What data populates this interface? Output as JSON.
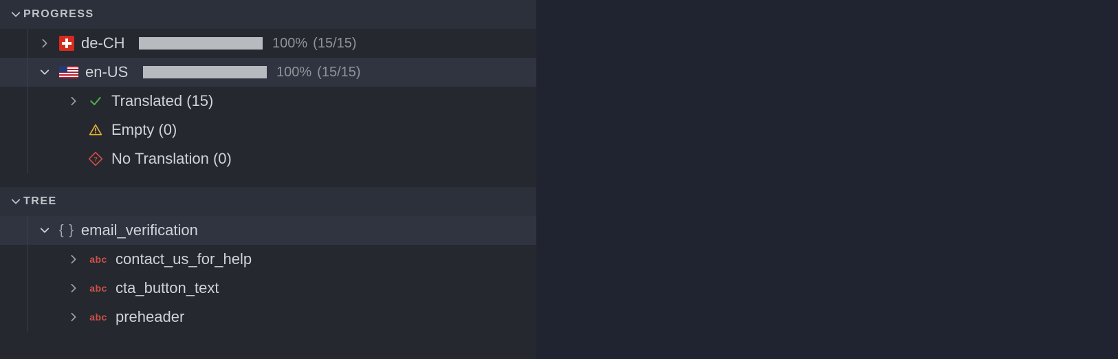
{
  "progress": {
    "title": "PROGRESS",
    "locales": [
      {
        "code": "de-CH",
        "flag": "ch",
        "percent": "100%",
        "ratio": "(15/15)",
        "expanded": false
      },
      {
        "code": "en-US",
        "flag": "us",
        "percent": "100%",
        "ratio": "(15/15)",
        "expanded": true,
        "statuses": [
          {
            "kind": "translated",
            "label": "Translated (15)",
            "expandable": true
          },
          {
            "kind": "empty",
            "label": "Empty (0)",
            "expandable": false
          },
          {
            "kind": "no-translation",
            "label": "No Translation (0)",
            "expandable": false
          }
        ]
      }
    ]
  },
  "tree": {
    "title": "TREE",
    "root": {
      "key": "email_verification",
      "children": [
        {
          "key": "contact_us_for_help"
        },
        {
          "key": "cta_button_text"
        },
        {
          "key": "preheader"
        }
      ]
    }
  },
  "icons": {
    "abc": "abc"
  }
}
